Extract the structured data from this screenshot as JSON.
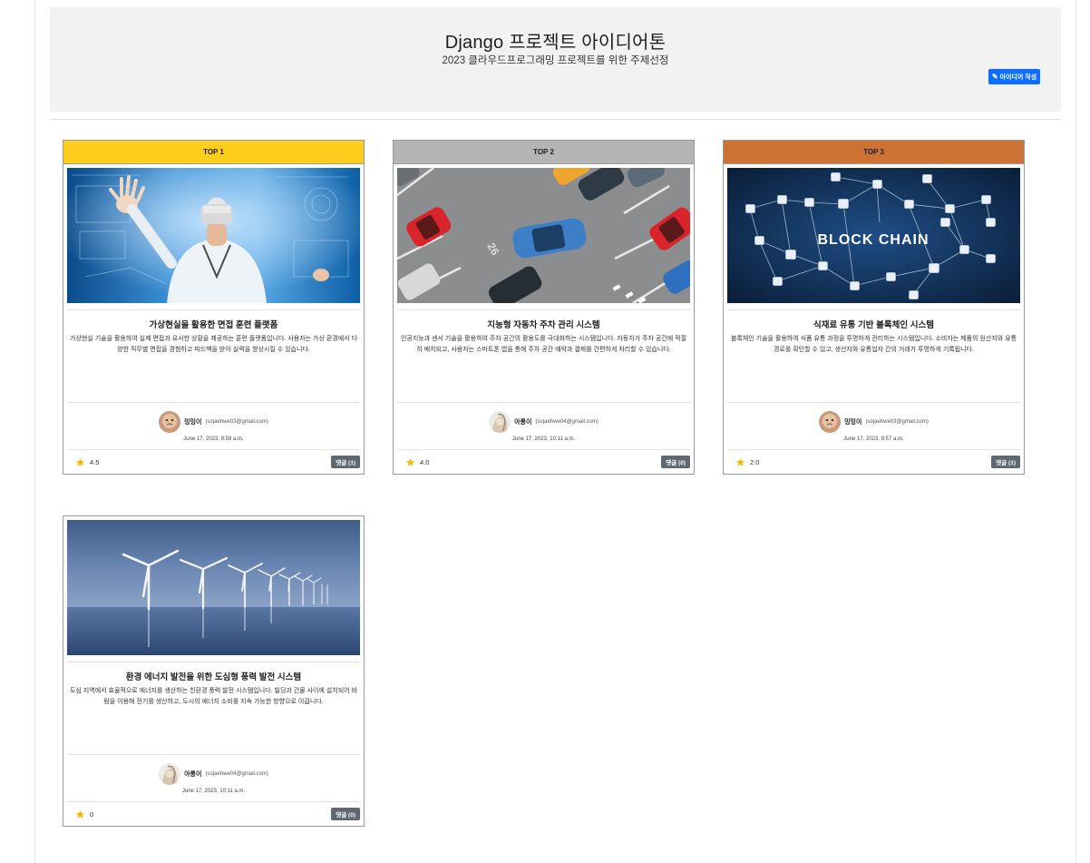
{
  "hero": {
    "title": "Django 프로젝트 아이디어톤",
    "subtitle": "2023 클라우드프로그래밍 프로젝트를 위한 주제선정",
    "write_button": "아이디어 작성",
    "write_icon": "pencil-icon"
  },
  "colors": {
    "gold": "#ffcd1e",
    "silver": "#b5b5b5",
    "bronze": "#cd7232",
    "primary": "#0d6efd",
    "secondary": "#5f6770",
    "star": "#f5b800"
  },
  "cards": [
    {
      "rank": "TOP 1",
      "title": "가상현실을 활용한 면접 훈련 플랫폼",
      "desc": "가상현실 기술을 활용하여 실제 면접과 유사한 상황을 제공하는 훈련 플랫폼입니다. 사용자는 가상 환경에서 다양한 직무별 면접을 경험하고 피드백을 받아 실력을 향상시킬 수 있습니다.",
      "author": "밍밍이",
      "email": "(sojaehwe03@gmail.com)",
      "date": "June 17, 2023, 9:59 a.m.",
      "rating": "4.5",
      "comments": "댓글 (1)",
      "image": "vr-doctor-image"
    },
    {
      "rank": "TOP 2",
      "title": "지능형 자동차 주차 관리 시스템",
      "desc": "인공지능과 센서 기술을 활용하여 주차 공간의 활용도를 극대화하는 시스템입니다. 자동차가 주차 공간에 적절히 배치되고, 사용자는 스마트폰 앱을 통해 주차 공간 예약과 결제를 간편하게 처리할 수 있습니다.",
      "author": "아롱이",
      "email": "(sojaehwe04@gmail.com)",
      "date": "June 17, 2023, 10:11 a.m.",
      "rating": "4.0",
      "comments": "댓글 (0)",
      "image": "parking-lot-image"
    },
    {
      "rank": "TOP 3",
      "title": "식재료 유통 기반 블록체인 시스템",
      "desc": "블록체인 기술을 활용하여 식품 유통 과정을 투명하게 관리하는 시스템입니다. 소비자는 제품의 원산지와 유통 경로를 확인할 수 있고, 생산자와 유통업자 간의 거래가 투명하게 기록됩니다.",
      "author": "밍밍이",
      "email": "(sojaehwe03@gmail.com)",
      "date": "June 17, 2023, 9:57 a.m.",
      "rating": "2.0",
      "comments": "댓글 (1)",
      "image": "blockchain-image",
      "image_text": "BLOCK CHAIN"
    },
    {
      "rank": "",
      "title": "환경 에너지 발전을 위한 도심형 풍력 발전 시스템",
      "desc": "도심 지역에서 효율적으로 에너지를 생산하는 친환경 풍력 발전 시스템입니다. 빌딩과 건물 사이에 설치되어 바람을 이용해 전기를 생산하고, 도시의 에너지 소비를 지속 가능한 방향으로 이끕니다.",
      "author": "아롱이",
      "email": "(sojaehwe04@gmail.com)",
      "date": "June 17, 2023, 10:11 a.m.",
      "rating": "0",
      "comments": "댓글 (0)",
      "image": "wind-turbine-image"
    }
  ]
}
